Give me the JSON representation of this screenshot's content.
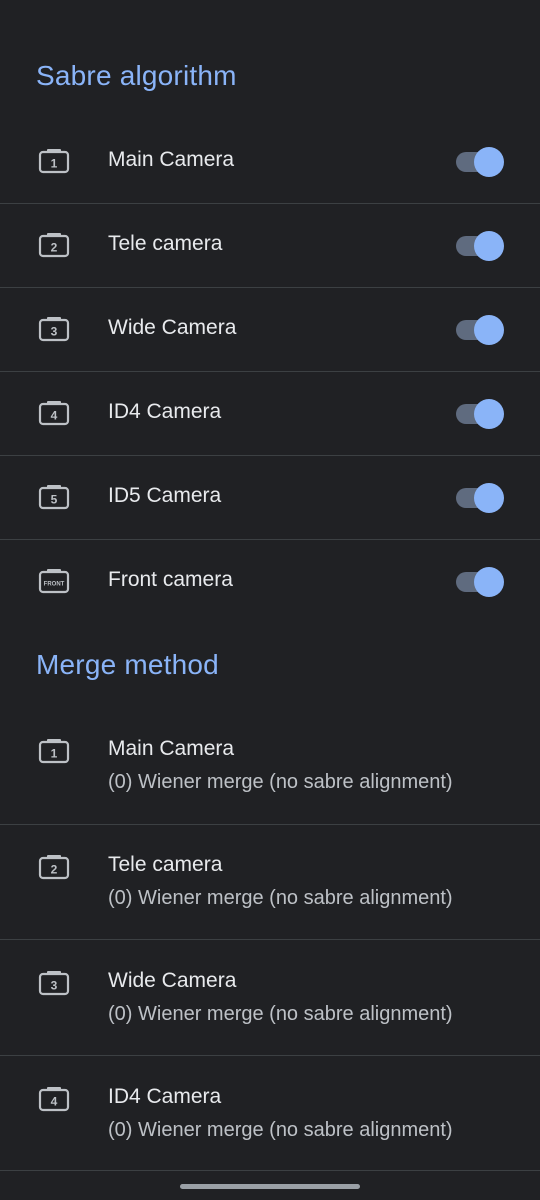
{
  "sabre": {
    "title": "Sabre algorithm",
    "items": [
      {
        "icon": "camera-1-icon",
        "badge": "1",
        "label": "Main Camera",
        "enabled": true
      },
      {
        "icon": "camera-2-icon",
        "badge": "2",
        "label": "Tele camera",
        "enabled": true
      },
      {
        "icon": "camera-3-icon",
        "badge": "3",
        "label": "Wide Camera",
        "enabled": true
      },
      {
        "icon": "camera-4-icon",
        "badge": "4",
        "label": "ID4 Camera",
        "enabled": true
      },
      {
        "icon": "camera-5-icon",
        "badge": "5",
        "label": "ID5 Camera",
        "enabled": true
      },
      {
        "icon": "camera-front-icon",
        "badge": "FRONT",
        "label": "Front camera",
        "enabled": true
      }
    ]
  },
  "merge": {
    "title": "Merge method",
    "items": [
      {
        "icon": "camera-1-icon",
        "badge": "1",
        "label": "Main Camera",
        "summary": "(0) Wiener merge (no sabre alignment)"
      },
      {
        "icon": "camera-2-icon",
        "badge": "2",
        "label": "Tele camera",
        "summary": "(0) Wiener merge (no sabre alignment)"
      },
      {
        "icon": "camera-3-icon",
        "badge": "3",
        "label": "Wide Camera",
        "summary": "(0) Wiener merge (no sabre alignment)"
      },
      {
        "icon": "camera-4-icon",
        "badge": "4",
        "label": "ID4 Camera",
        "summary": "(0) Wiener merge (no sabre alignment)"
      }
    ]
  },
  "colors": {
    "background": "#202124",
    "accent": "#8ab4f8",
    "toggle_track": "#5f6b7f",
    "divider": "#3c4043"
  }
}
